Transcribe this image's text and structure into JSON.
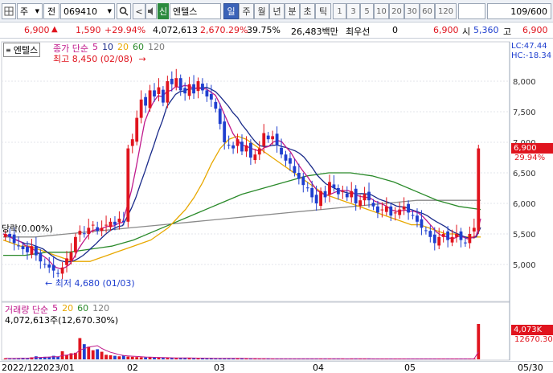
{
  "toolbar": {
    "market_icon": "grid-icon",
    "market_select": "주",
    "code_type": "전",
    "stock_code": "069410",
    "search_icon": "magnifier-icon",
    "prev_label": "<",
    "sound_icon": "speaker-icon",
    "new_badge": "신",
    "stock_name": "엔텔스",
    "periods": [
      {
        "label": "일",
        "selected": true
      },
      {
        "label": "주",
        "selected": false
      },
      {
        "label": "월",
        "selected": false
      },
      {
        "label": "년",
        "selected": false
      },
      {
        "label": "분",
        "selected": false
      },
      {
        "label": "초",
        "selected": false
      },
      {
        "label": "틱",
        "selected": false
      }
    ],
    "intervals": [
      "1",
      "3",
      "5",
      "10",
      "20",
      "30",
      "60",
      "120"
    ],
    "count": "109/600"
  },
  "quote": {
    "price": "6,900",
    "change": "1,590",
    "change_pct": "+29.94%",
    "volume": "4,072,613",
    "volume_pct": "2,670.29%",
    "turnover": "39.75%",
    "amount": "26,483백만",
    "best_label": "최우선",
    "best_value": "0",
    "current": "6,900",
    "open_label": "시",
    "open": "5,360",
    "high_label": "고",
    "high": "6,900"
  },
  "chart": {
    "stock_label": "엔텔스",
    "legend_title": "종가 단순",
    "ma_periods": [
      {
        "label": "5",
        "color": "#c01a8c"
      },
      {
        "label": "10",
        "color": "#1a2b8a"
      },
      {
        "label": "20",
        "color": "#e8a800"
      },
      {
        "label": "60",
        "color": "#2a8a2a"
      },
      {
        "label": "120",
        "color": "#7a7a7a"
      }
    ],
    "high_note": "최고 8,450 (02/08)",
    "low_note": "최저 4,680 (01/03)",
    "limit_note": "당락(0.00%)",
    "lc": "LC:47.44",
    "hc": "HC:-18.34",
    "price_ticks": [
      "8,000",
      "7,500",
      "7,000",
      "6,500",
      "6,000",
      "5,500",
      "5,000"
    ],
    "last_price_tag": "6,900",
    "last_pct_tag": "29.94%",
    "volume_title": "거래량 단순",
    "volume_ma": [
      "5",
      "20",
      "60",
      "120"
    ],
    "volume_note": "4,072,613주(12,670.30%)",
    "volume_tag": "4,073K",
    "volume_pct_tag": "12670.30",
    "date_labels": [
      "2022/12",
      "2023/01",
      "02",
      "03",
      "04",
      "05",
      "05/30"
    ]
  },
  "chart_data": {
    "type": "candlestick",
    "price_axis": [
      5000,
      8000
    ],
    "high": {
      "value": 8450,
      "date": "02/08"
    },
    "low": {
      "value": 4680,
      "date": "01/03"
    },
    "close_series": [
      5500,
      5450,
      5350,
      5300,
      5250,
      5200,
      5300,
      5150,
      5050,
      5000,
      4950,
      4900,
      4850,
      4950,
      5100,
      5200,
      5450,
      5550,
      5500,
      5600,
      5650,
      5550,
      5600,
      5650,
      5700,
      5650,
      5750,
      5700,
      6900,
      7050,
      7400,
      7700,
      7600,
      7850,
      7750,
      7900,
      7650,
      8000,
      7950,
      8050,
      7850,
      7800,
      7950,
      7800,
      8000,
      7850,
      7750,
      7700,
      7550,
      7300,
      7000,
      6950,
      6900,
      7050,
      6850,
      6950,
      6750,
      6800,
      6900,
      7150,
      7050,
      7100,
      6950,
      6800,
      6700,
      6650,
      6500,
      6400,
      6300,
      6250,
      6100,
      6000,
      6200,
      6100,
      6350,
      6250,
      6150,
      6200,
      6100,
      6200,
      6000,
      6050,
      6150,
      6050,
      5950,
      5850,
      5900,
      5950,
      5800,
      5850,
      5900,
      5950,
      5850,
      5800,
      5700,
      5600,
      5550,
      5450,
      5350,
      5450,
      5500,
      5400,
      5450,
      5500,
      5400,
      5350,
      5500,
      5600,
      6900
    ],
    "ma20_series": [
      5400,
      5350,
      5300,
      5300,
      5250,
      5200,
      5150,
      5100,
      5050,
      5050,
      5050,
      5100,
      5150,
      5200,
      5250,
      5300,
      5350,
      5400,
      5500,
      5600,
      5750,
      5900,
      6100,
      6350,
      6650,
      6900,
      7050,
      7100,
      7050,
      6950,
      6850,
      6750,
      6650,
      6550,
      6450,
      6350,
      6250,
      6150,
      6100,
      6050,
      6000,
      5950,
      5900,
      5850,
      5800,
      5750,
      5700,
      5650,
      5650,
      5600,
      5550,
      5500,
      5500,
      5450,
      5450,
      5450
    ],
    "ma60_series": [
      5150,
      5150,
      5200,
      5200,
      5250,
      5300,
      5400,
      5550,
      5700,
      5850,
      6000,
      6150,
      6250,
      6350,
      6450,
      6500,
      6500,
      6450,
      6350,
      6200,
      6050,
      5950,
      5900
    ],
    "ma120_series": [
      5450,
      5450,
      5500,
      5550,
      5600,
      5650,
      5700,
      5750,
      5800,
      5850,
      5900,
      5950,
      6000,
      6050,
      6050,
      6050
    ],
    "volume_series": [
      20,
      15,
      18,
      22,
      30,
      25,
      40,
      60,
      35,
      50,
      45,
      70,
      55,
      160,
      90,
      120,
      130,
      420,
      300,
      250,
      180,
      200,
      150,
      90,
      80,
      70,
      60,
      75,
      55,
      50,
      45,
      40,
      38,
      42,
      35,
      33,
      30,
      28,
      25,
      30,
      28,
      26,
      24,
      22,
      20,
      25,
      22,
      20,
      18,
      22,
      20,
      18,
      16,
      20,
      18,
      15,
      14,
      13,
      12,
      15,
      14,
      13,
      12,
      11,
      10,
      12,
      11,
      10,
      12,
      14,
      13,
      11,
      10,
      12,
      11,
      10,
      9,
      10,
      11,
      12,
      10,
      9,
      10,
      11,
      9,
      8,
      10,
      12,
      10,
      9,
      8,
      9,
      10,
      11,
      9,
      8,
      9,
      10,
      9,
      8,
      9,
      10,
      9,
      8,
      9,
      10,
      11,
      12,
      700
    ],
    "volume_unit": "K",
    "dates": [
      "2022/12",
      "2023/01",
      "02",
      "03",
      "04",
      "05",
      "05/30"
    ]
  }
}
